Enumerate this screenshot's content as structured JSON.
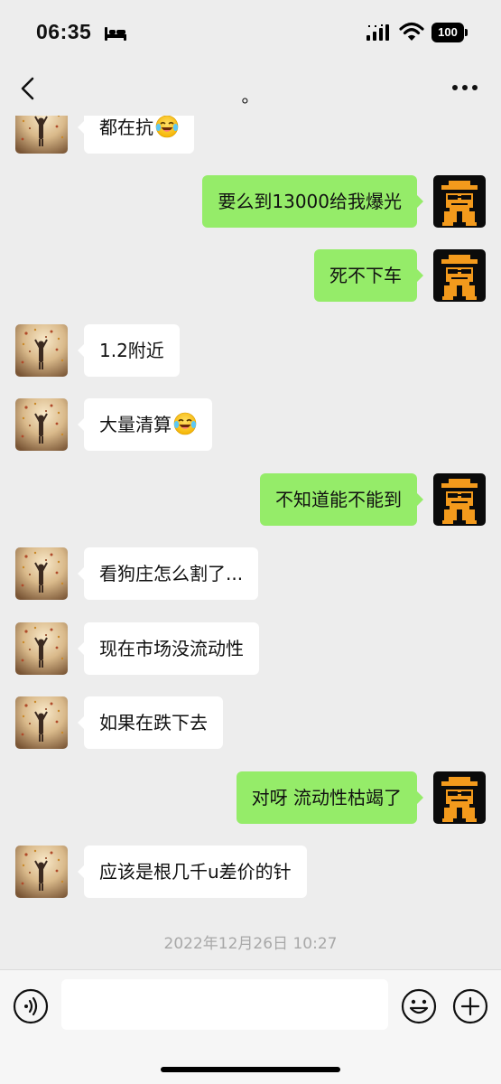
{
  "status_bar": {
    "time": "06:35",
    "battery": "100"
  },
  "nav": {
    "title": "。"
  },
  "messages": [
    {
      "side": "left",
      "text": "都在抗",
      "emoji": "crying-laughing-emoji"
    },
    {
      "side": "right",
      "text": "要么到13000给我爆光"
    },
    {
      "side": "right",
      "text": "死不下车"
    },
    {
      "side": "left",
      "text": "1.2附近"
    },
    {
      "side": "left",
      "text": "大量清算",
      "emoji": "crying-laughing-emoji"
    },
    {
      "side": "right",
      "text": "不知道能不能到"
    },
    {
      "side": "left",
      "text": "看狗庄怎么割了..."
    },
    {
      "side": "left",
      "text": "现在市场没流动性"
    },
    {
      "side": "left",
      "text": "如果在跌下去"
    },
    {
      "side": "right",
      "text": "对呀 流动性枯竭了"
    },
    {
      "side": "left",
      "text": "应该是根几千u差价的针"
    }
  ],
  "timestamp": "2022年12月26日 10:27",
  "input": {
    "value": "",
    "placeholder": ""
  },
  "colors": {
    "sent_bubble": "#95ec69",
    "received_bubble": "#ffffff",
    "background": "#ededed"
  }
}
